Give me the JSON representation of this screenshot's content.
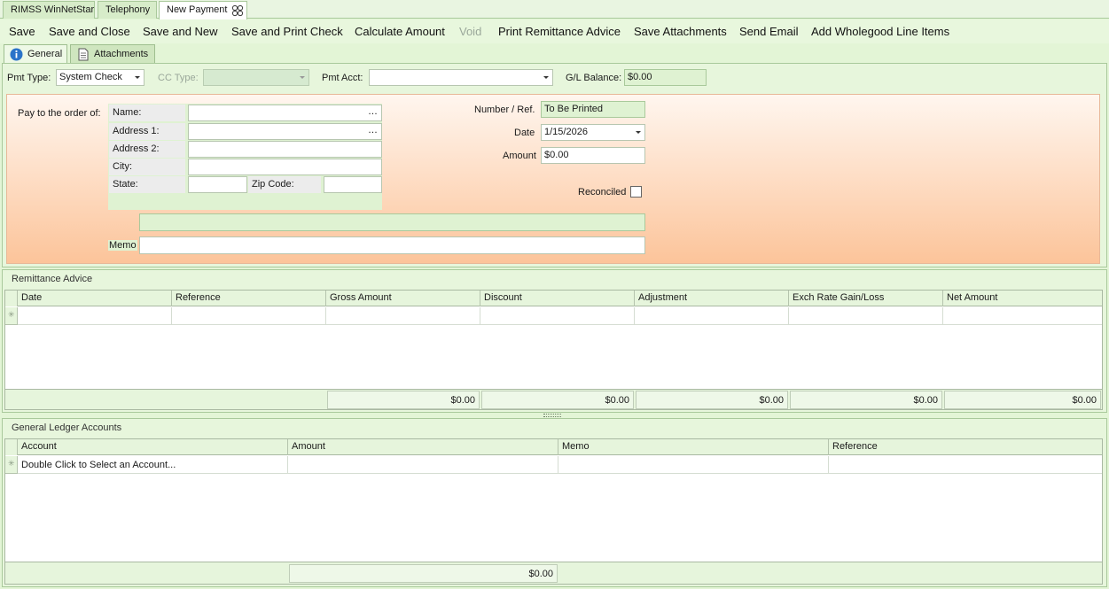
{
  "top_tabs": [
    {
      "label": "RIMSS WinNetStar"
    },
    {
      "label": "Telephony"
    },
    {
      "label": "New Payment"
    }
  ],
  "toolbar": {
    "save": "Save",
    "save_close": "Save and Close",
    "save_new": "Save and New",
    "save_print": "Save and Print Check",
    "calc": "Calculate Amount",
    "void": "Void",
    "print_remit": "Print Remittance Advice",
    "save_attach": "Save Attachments",
    "send_email": "Send Email",
    "add_wholegood": "Add Wholegood Line Items"
  },
  "inner_tabs": {
    "general": "General",
    "attachments": "Attachments"
  },
  "payment_bar": {
    "pmt_type_label": "Pmt Type:",
    "pmt_type_value": "System Check",
    "cc_type_label": "CC Type:",
    "cc_type_value": "",
    "pmt_acct_label": "Pmt Acct:",
    "pmt_acct_value": "",
    "gl_balance_label": "G/L Balance:",
    "gl_balance_value": "$0.00"
  },
  "check": {
    "pay_to_label": "Pay to the order of:",
    "name_label": "Name:",
    "address1_label": "Address 1:",
    "address2_label": "Address 2:",
    "city_label": "City:",
    "state_label": "State:",
    "zip_label": "Zip Code:",
    "ellipsis": "…",
    "number_label": "Number / Ref.",
    "number_value": "To Be Printed",
    "date_label": "Date",
    "date_value": "1/15/2026",
    "amount_label": "Amount",
    "amount_value": "$0.00",
    "reconciled_label": "Reconciled",
    "memo_label": "Memo",
    "memo_value": ""
  },
  "remittance": {
    "title": "Remittance Advice",
    "columns": [
      "Date",
      "Reference",
      "Gross Amount",
      "Discount",
      "Adjustment",
      "Exch Rate Gain/Loss",
      "Net Amount"
    ],
    "totals": [
      "$0.00",
      "$0.00",
      "$0.00",
      "$0.00",
      "$0.00"
    ]
  },
  "gl": {
    "title": "General Ledger Accounts",
    "columns": [
      "Account",
      "Amount",
      "Memo",
      "Reference"
    ],
    "new_row_prompt": "Double Click to Select an Account...",
    "total": "$0.00"
  },
  "colors": {
    "accent_green": "#e3f5d6",
    "check_gradient_top": "#fff6ef",
    "check_gradient_bottom": "#fcc49a"
  }
}
